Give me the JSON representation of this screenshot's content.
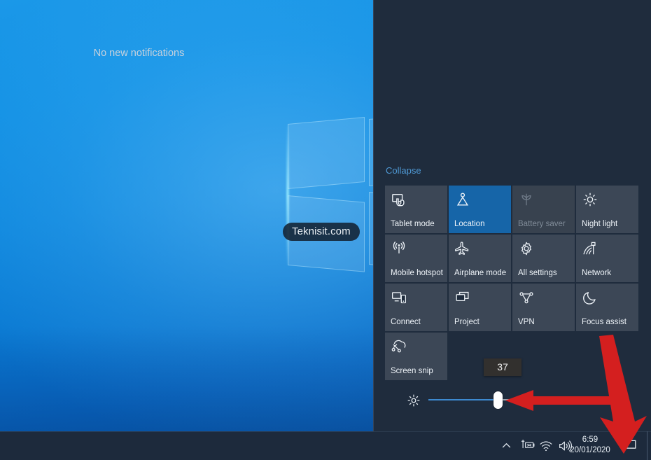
{
  "desktop": {
    "watermark": "Teknisit.com"
  },
  "action_center": {
    "notifications_text": "No new notifications",
    "collapse_label": "Collapse",
    "accent_color": "#1665a8",
    "panel_color": "#1f2c3d",
    "tiles": [
      {
        "label": "Tablet mode",
        "icon": "tablet-mode-icon",
        "state": "off"
      },
      {
        "label": "Location",
        "icon": "location-icon",
        "state": "on"
      },
      {
        "label": "Battery saver",
        "icon": "battery-saver-icon",
        "state": "disabled"
      },
      {
        "label": "Night light",
        "icon": "night-light-icon",
        "state": "off"
      },
      {
        "label": "Mobile hotspot",
        "icon": "mobile-hotspot-icon",
        "state": "off"
      },
      {
        "label": "Airplane mode",
        "icon": "airplane-mode-icon",
        "state": "off"
      },
      {
        "label": "All settings",
        "icon": "gear-icon",
        "state": "off"
      },
      {
        "label": "Network",
        "icon": "network-icon",
        "state": "off"
      },
      {
        "label": "Connect",
        "icon": "connect-icon",
        "state": "off"
      },
      {
        "label": "Project",
        "icon": "project-icon",
        "state": "off"
      },
      {
        "label": "VPN",
        "icon": "vpn-icon",
        "state": "off"
      },
      {
        "label": "Focus assist",
        "icon": "moon-icon",
        "state": "off"
      },
      {
        "label": "Screen snip",
        "icon": "screen-snip-icon",
        "state": "off"
      }
    ],
    "brightness": {
      "icon": "brightness-icon",
      "value": "37",
      "min": "0",
      "max": "100"
    }
  },
  "taskbar": {
    "time": "6:59",
    "date": "20/01/2020",
    "tray_icons": [
      "chevron-up-icon",
      "battery-not-present-icon",
      "wifi-icon",
      "volume-icon"
    ],
    "action_center_icon": "speech-bubble-icon"
  },
  "annotations": {
    "arrow_color": "#d41f1f",
    "arrows": [
      {
        "name": "slider-arrow",
        "points_to": "brightness-slider-thumb"
      },
      {
        "name": "taskbar-arrow",
        "points_to": "action-center-button"
      }
    ]
  }
}
